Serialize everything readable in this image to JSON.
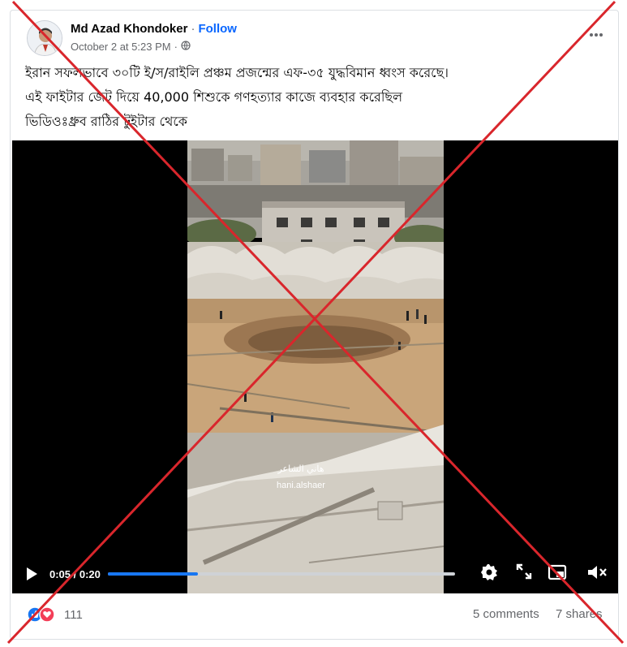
{
  "post": {
    "author": "Md Azad Khondoker",
    "separator": "·",
    "follow_label": "Follow",
    "timestamp": "October 2 at 5:23 PM",
    "meta_separator": "·",
    "more_icon": "ellipsis-icon",
    "text_lines": [
      "ইরান সফলভাবে ৩০টি ই/স/রাইলি প্রঞ্চম প্রজন্মের এফ-৩৫ যুদ্ধবিমান ধ্বংস করেছে।",
      "এই ফাইটার জেট দিয়ে 40,000 শিশুকে গণহত্যার কাজে ব্যবহার করেছিল",
      "ভিডিওঃধ্রুব রাঠির টুইটার থেকে"
    ]
  },
  "video": {
    "watermark_arabic": "هاني الشاعر",
    "watermark_latin": "hani.alshaer",
    "current_time": "0:05",
    "duration": "0:20",
    "time_separator": " / ",
    "progress": 0.26
  },
  "stats": {
    "reaction_count": "111",
    "comments": "5 comments",
    "shares": "7 shares"
  },
  "colors": {
    "accent": "#0866ff",
    "progress": "#1877f2",
    "cross": "#d9262c",
    "like": "#1877f2",
    "love": "#f33e58"
  }
}
